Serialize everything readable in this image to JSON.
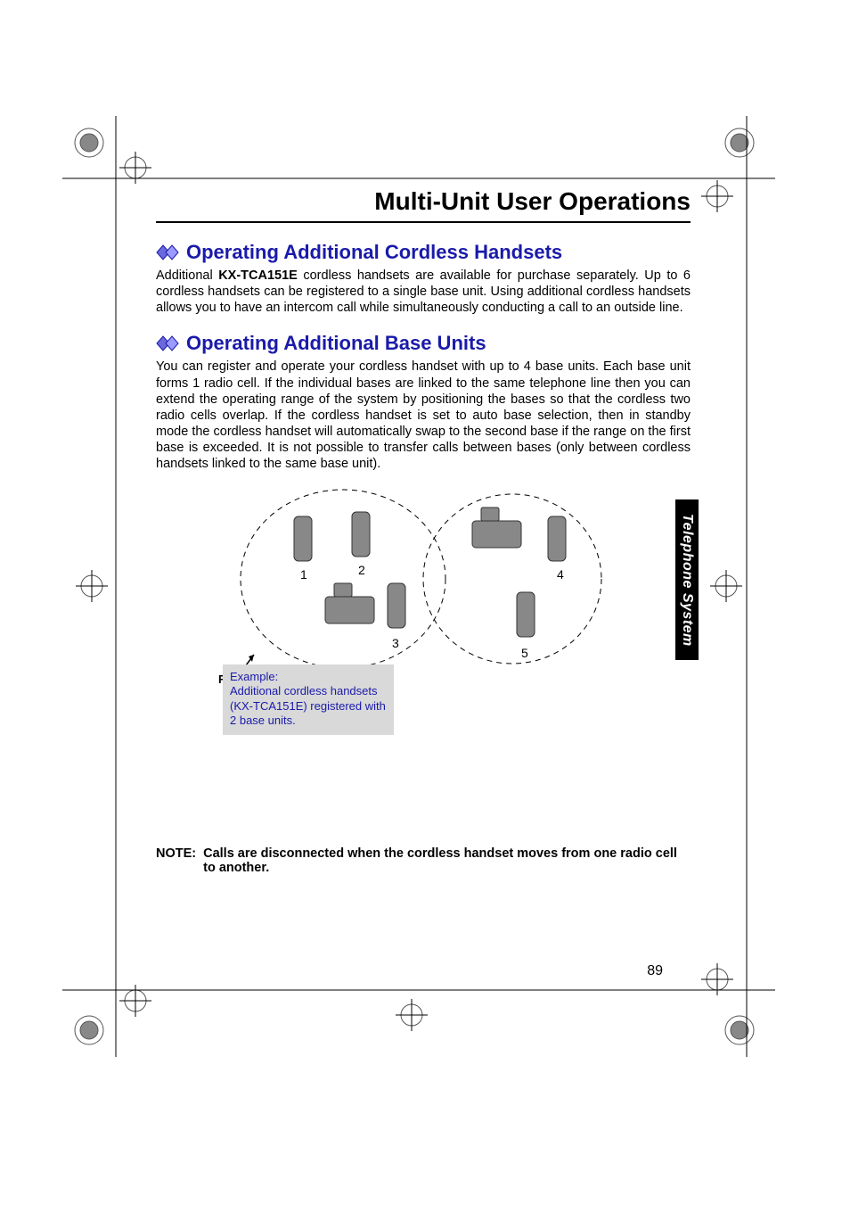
{
  "header": {
    "title": "Multi-Unit User Operations"
  },
  "sections": {
    "handsets": {
      "heading": "Operating Additional Cordless Handsets",
      "text_pre": "Additional ",
      "model": "KX-TCA151E",
      "text_post": " cordless handsets are available for purchase separately. Up to 6 cordless handsets can be registered to a single base unit. Using additional cordless handsets allows you to have an intercom call while simultaneously conducting a call to an outside line."
    },
    "bases": {
      "heading": "Operating Additional Base Units",
      "text": "You can register and operate your cordless handset with up to 4 base units. Each base unit forms 1 radio cell. If the individual bases are linked to the same telephone line then you can extend the operating range of the system by positioning the bases so that the cordless two radio cells overlap. If the cordless handset is set to auto base selection, then in standby mode the cordless handset will automatically swap to the second base if the range on the first base is exceeded. It is not possible to transfer calls between bases (only between cordless handsets linked to the same base unit)."
    }
  },
  "diagram": {
    "radio_cell_label": "Radio Cell",
    "numbers": {
      "n1": "1",
      "n2": "2",
      "n3": "3",
      "n4": "4",
      "n5": "5"
    },
    "example": "Example:\nAdditional cordless handsets (KX-TCA151E) registered with 2 base units."
  },
  "note": {
    "label": "NOTE:",
    "text": "Calls are disconnected when the cordless handset moves from one radio cell to another."
  },
  "side_tab": "Telephone System",
  "page_number": "89"
}
